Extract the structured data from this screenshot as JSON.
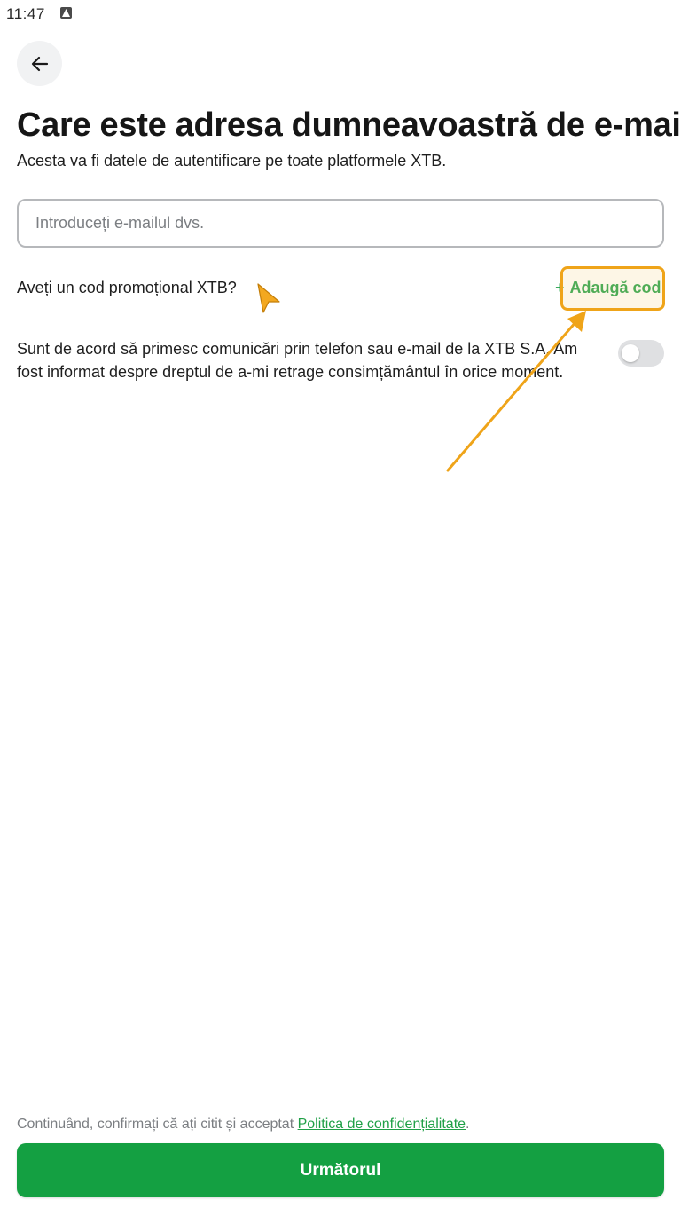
{
  "status_bar": {
    "time": "11:47"
  },
  "header": {
    "title": "Care este adresa dumneavoastră de e-mail?",
    "subtitle": "Acesta va fi datele de autentificare pe toate platformele XTB."
  },
  "email": {
    "value": "",
    "placeholder": "Introduceți e-mailul dvs."
  },
  "promo": {
    "question": "Aveți un cod promoțional XTB?",
    "add_icon": "+",
    "add_label": "Adaugă cod"
  },
  "consent": {
    "text": "Sunt de acord să primesc comunicări prin telefon sau e-mail de la XTB S.A. Am fost informat despre dreptul de a-mi retrage consimțământul în orice moment.",
    "checked": false
  },
  "footer": {
    "legal_prefix": "Continuând, confirmați că ați citit și acceptat ",
    "privacy_link": "Politica de confidențialitate",
    "legal_suffix": ".",
    "next_label": "Următorul"
  },
  "colors": {
    "accent_green": "#20a047",
    "button_green": "#14a042",
    "highlight_orange": "#efa419"
  }
}
